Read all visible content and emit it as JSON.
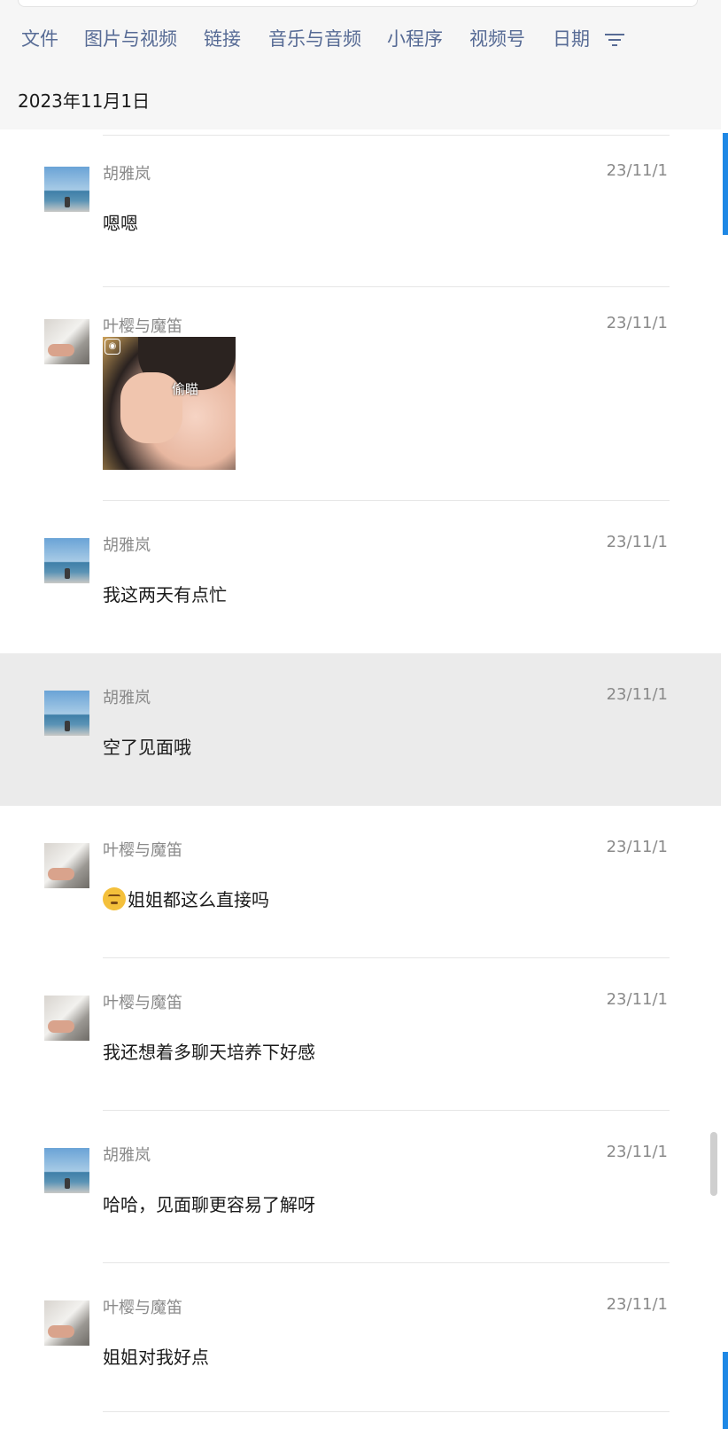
{
  "tabs": [
    {
      "label": "文件"
    },
    {
      "label": "图片与视频"
    },
    {
      "label": "链接"
    },
    {
      "label": "音乐与音频"
    },
    {
      "label": "小程序"
    },
    {
      "label": "视频号"
    },
    {
      "label": "日期"
    }
  ],
  "date_header": "2023年11月1日",
  "messages": [
    {
      "sender": "胡雅岚",
      "time": "23/11/1",
      "text": "嗯嗯"
    },
    {
      "sender": "叶樱与魔笛",
      "time": "23/11/1",
      "sticker_caption": "偷瞄"
    },
    {
      "sender": "胡雅岚",
      "time": "23/11/1",
      "text": "我这两天有点忙"
    },
    {
      "sender": "胡雅岚",
      "time": "23/11/1",
      "text": "空了见面哦"
    },
    {
      "sender": "叶樱与魔笛",
      "time": "23/11/1",
      "text": "姐姐都这么直接吗",
      "emoji": "thinking-face"
    },
    {
      "sender": "叶樱与魔笛",
      "time": "23/11/1",
      "text": "我还想着多聊天培养下好感"
    },
    {
      "sender": "胡雅岚",
      "time": "23/11/1",
      "text": "哈哈，见面聊更容易了解呀"
    },
    {
      "sender": "叶樱与魔笛",
      "time": "23/11/1",
      "text": "姐姐对我好点"
    }
  ],
  "colors": {
    "tab": "#576b95",
    "highlight_row": "#ebebeb",
    "header_bg": "#f6f6f6"
  }
}
